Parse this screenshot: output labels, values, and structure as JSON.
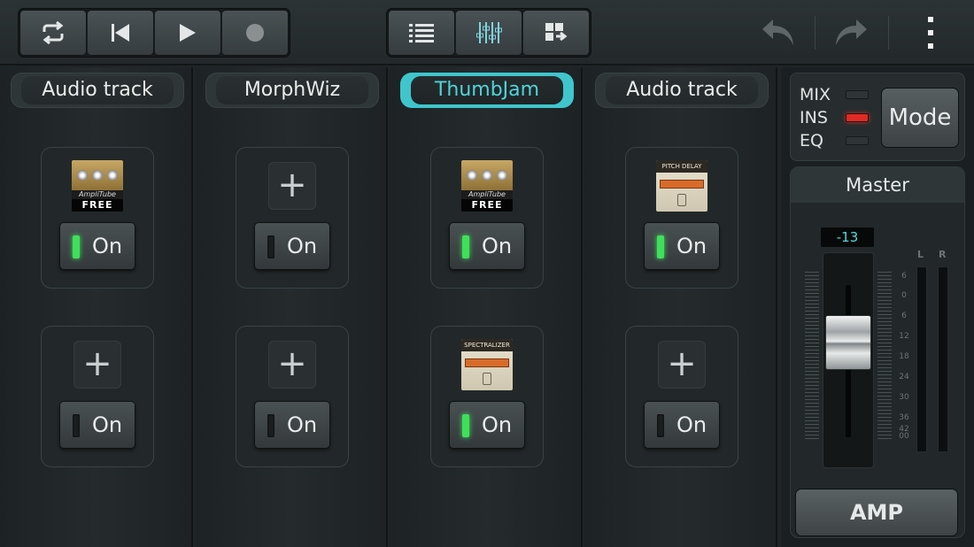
{
  "toolbar": {
    "transport": [
      {
        "icon": "loop-icon"
      },
      {
        "icon": "skip-back-icon"
      },
      {
        "icon": "play-icon"
      },
      {
        "icon": "record-icon"
      }
    ],
    "views": [
      {
        "icon": "list-view-icon"
      },
      {
        "icon": "mixer-icon",
        "active": true
      },
      {
        "icon": "grid-view-icon"
      }
    ],
    "actions": [
      {
        "icon": "undo-icon"
      },
      {
        "icon": "redo-icon"
      },
      {
        "icon": "more-vert-icon"
      }
    ]
  },
  "tracks": [
    {
      "name": "Audio track",
      "selected": false,
      "slots": [
        {
          "plugin": "AmpliTube FREE",
          "on_label": "On",
          "on": true
        },
        {
          "plugin": null,
          "on_label": "On",
          "on": false
        }
      ]
    },
    {
      "name": "MorphWiz",
      "selected": false,
      "slots": [
        {
          "plugin": null,
          "on_label": "On",
          "on": false
        },
        {
          "plugin": null,
          "on_label": "On",
          "on": false
        }
      ]
    },
    {
      "name": "ThumbJam",
      "selected": true,
      "slots": [
        {
          "plugin": "AmpliTube FREE",
          "on_label": "On",
          "on": true
        },
        {
          "plugin": "Spectralizer",
          "on_label": "On",
          "on": true
        }
      ]
    },
    {
      "name": "Audio track",
      "selected": false,
      "slots": [
        {
          "plugin": "Pitch Delay",
          "on_label": "On",
          "on": true
        },
        {
          "plugin": null,
          "on_label": "On",
          "on": false
        }
      ]
    }
  ],
  "plugins": {
    "amplitube_word": "AmpliTube",
    "amplitube_free": "FREE",
    "pitch_delay": "PITCH DELAY",
    "spectralizer": "SPECTRALIZER"
  },
  "mode_panel": {
    "modes": [
      {
        "label": "MIX",
        "on": false
      },
      {
        "label": "INS",
        "on": true
      },
      {
        "label": "EQ",
        "on": false
      }
    ],
    "mode_button": "Mode"
  },
  "master": {
    "title": "Master",
    "db_value": "-13",
    "scale": [
      "6",
      "0",
      "6",
      "12",
      "18",
      "24",
      "30",
      "36",
      "42",
      "00"
    ],
    "meter_left": "L",
    "meter_right": "R",
    "amp_button": "AMP"
  },
  "colors": {
    "accent": "#3fc6cc",
    "led_green": "#3ee05a",
    "led_red": "#e22a24"
  }
}
